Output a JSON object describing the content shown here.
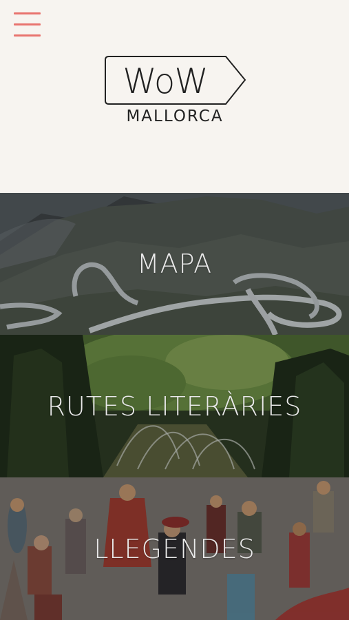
{
  "header": {
    "menu_icon": "hamburger-menu-icon",
    "accent_color": "#e8736e",
    "logo": {
      "title": "WoW",
      "subtitle": "MALLORCA"
    }
  },
  "sections": [
    {
      "label": "MAPA",
      "image": "mountain-serpentine-road"
    },
    {
      "label": "RUTES LITERÀRIES",
      "image": "garden-fountain-cypress"
    },
    {
      "label": "LLEGENDES",
      "image": "illustrated-legend-characters"
    }
  ]
}
